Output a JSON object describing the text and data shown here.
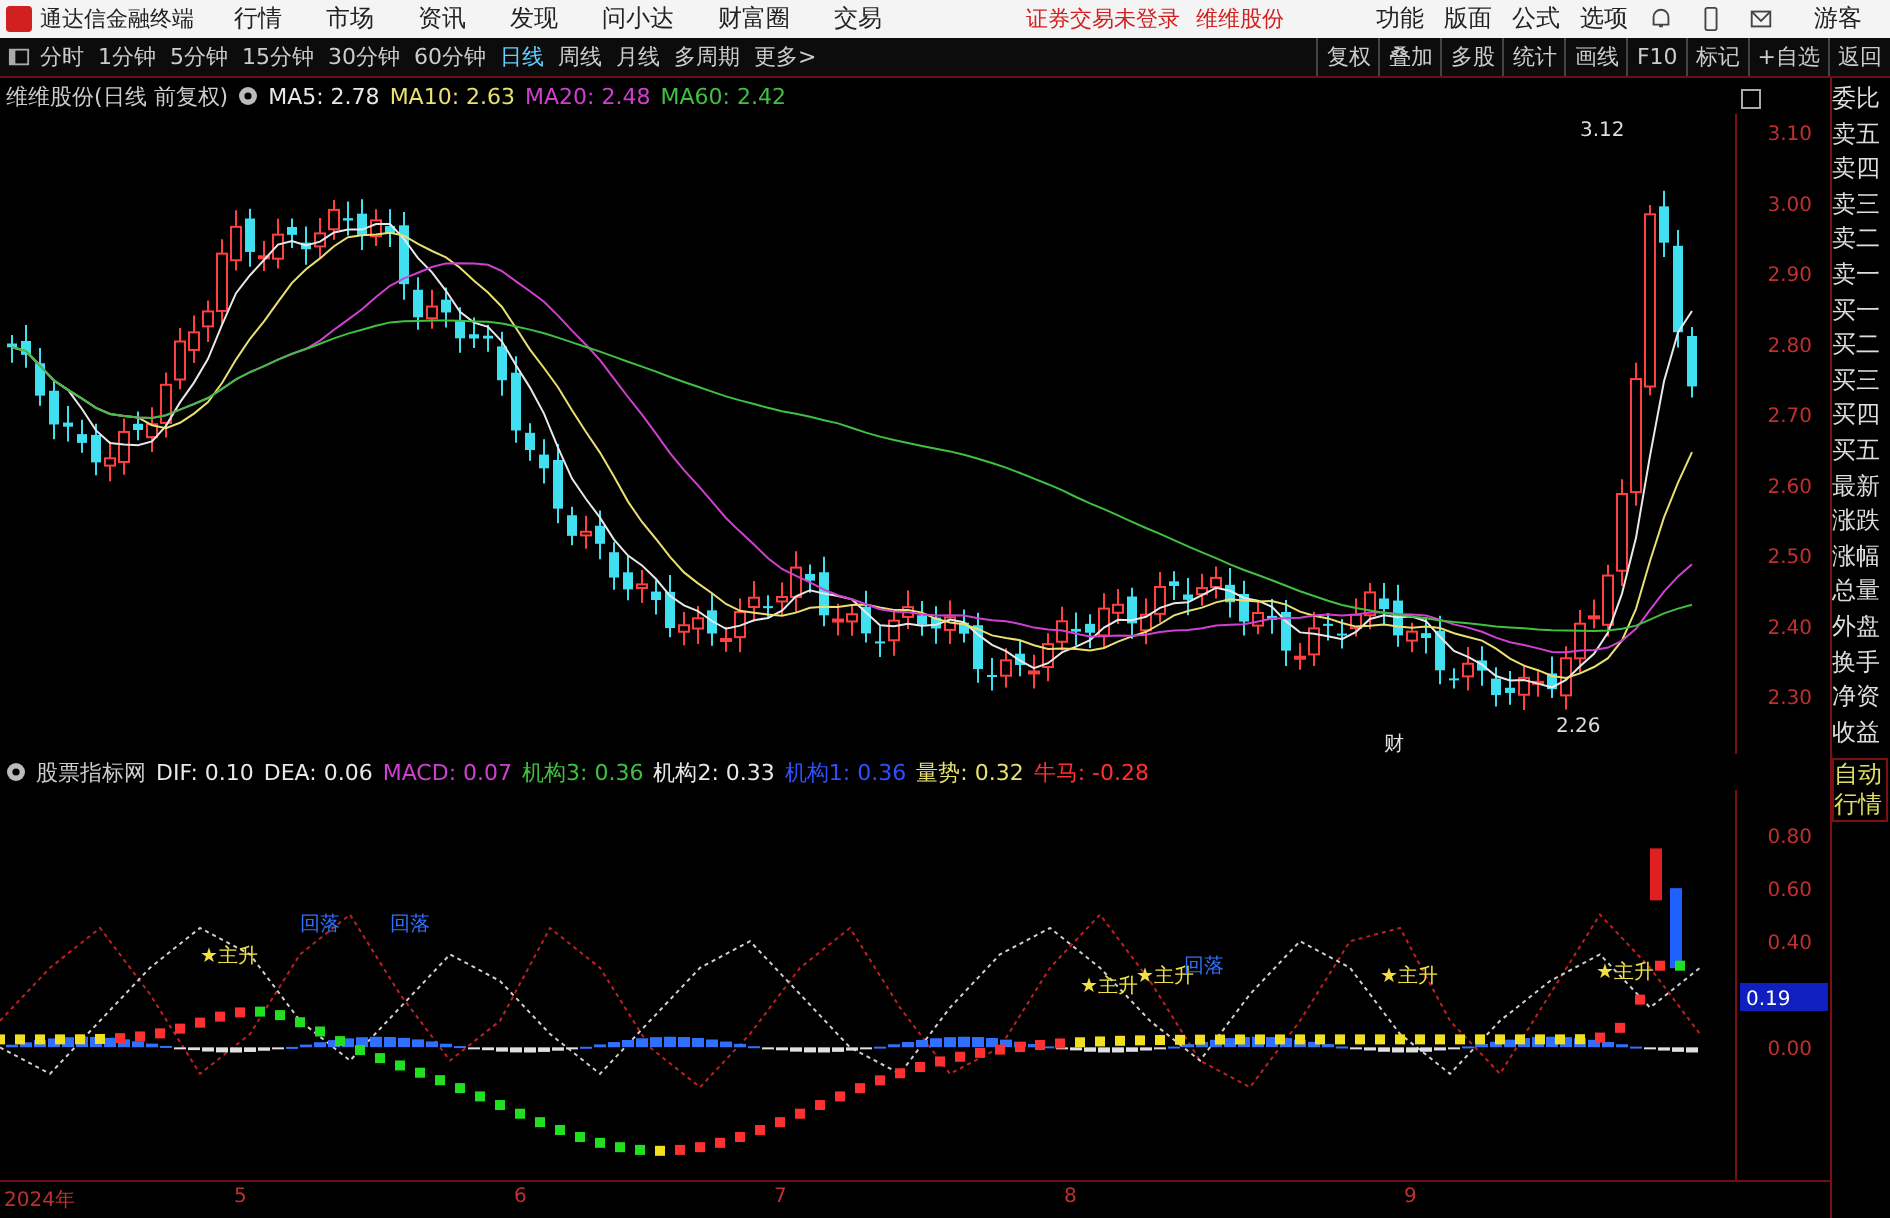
{
  "menubar": {
    "app_title": "通达信金融终端",
    "menus": [
      "行情",
      "市场",
      "资讯",
      "发现",
      "问小达",
      "财富圈",
      "交易"
    ],
    "notices": [
      "证券交易未登录",
      "维维股份"
    ],
    "actions": [
      "功能",
      "版面",
      "公式",
      "选项"
    ],
    "user": "游客"
  },
  "toolbar": {
    "periods": [
      {
        "label": "分时",
        "selected": false
      },
      {
        "label": "1分钟",
        "selected": false
      },
      {
        "label": "5分钟",
        "selected": false
      },
      {
        "label": "15分钟",
        "selected": false
      },
      {
        "label": "30分钟",
        "selected": false
      },
      {
        "label": "60分钟",
        "selected": false
      },
      {
        "label": "日线",
        "selected": true
      },
      {
        "label": "周线",
        "selected": false
      },
      {
        "label": "月线",
        "selected": false
      },
      {
        "label": "多周期",
        "selected": false
      }
    ],
    "more": "更多>",
    "tools": [
      "复权",
      "叠加",
      "多股",
      "统计",
      "画线",
      "F10",
      "标记",
      "+自选",
      "返回"
    ]
  },
  "chart": {
    "title": "维维股份(日线 前复权)",
    "ma": [
      {
        "label": "MA5: 2.78",
        "color": "#e8e8e8"
      },
      {
        "label": "MA10: 2.63",
        "color": "#e8e070"
      },
      {
        "label": "MA20: 2.48",
        "color": "#d040d0"
      },
      {
        "label": "MA60: 2.42",
        "color": "#40c040"
      }
    ],
    "price_ticks": [
      "3.10",
      "3.00",
      "2.90",
      "2.80",
      "2.70",
      "2.60",
      "2.50",
      "2.40",
      "2.30"
    ],
    "high_label": "3.12",
    "low_label": "2.26",
    "marker": "财"
  },
  "indicator": {
    "title": "股票指标网",
    "values": [
      {
        "label": "DIF: 0.10",
        "color": "#e8e8e8"
      },
      {
        "label": "DEA: 0.06",
        "color": "#e8e8e8"
      },
      {
        "label": "MACD: 0.07",
        "color": "#d040d0"
      },
      {
        "label": "机构3: 0.36",
        "color": "#40c040"
      },
      {
        "label": "机构2: 0.33",
        "color": "#e8e8e8"
      },
      {
        "label": "机构1: 0.36",
        "color": "#3050ff"
      },
      {
        "label": "量势: 0.32",
        "color": "#e8e070"
      },
      {
        "label": "牛马: -0.28",
        "color": "#ff3030"
      }
    ],
    "chart_data": {
      "type": "line",
      "ylim": [
        -0.5,
        0.97
      ],
      "yticks": [
        {
          "value": 0.8,
          "label": "0.80"
        },
        {
          "value": 0.6,
          "label": "0.60"
        },
        {
          "value": 0.4,
          "label": "0.40"
        },
        {
          "value": 0,
          "label": "0.00"
        }
      ],
      "series": [
        {
          "color": "#c02020",
          "line_style": "dashed",
          "values": [
            0.1,
            0.3,
            0.45,
            0.2,
            -0.1,
            0.05,
            0.35,
            0.5,
            0.2,
            -0.05,
            0.1,
            0.45,
            0.3,
            0.0,
            -0.15,
            0.05,
            0.3,
            0.45,
            0.15,
            -0.1,
            0.0,
            0.3,
            0.5,
            0.25,
            -0.05,
            -0.15,
            0.1,
            0.4,
            0.45,
            0.1,
            -0.1,
            0.2,
            0.5,
            0.3,
            0.05
          ]
        },
        {
          "color": "#d0d0d0",
          "line_style": "dashed",
          "values": [
            0.0,
            -0.1,
            0.1,
            0.3,
            0.45,
            0.35,
            0.1,
            -0.05,
            0.15,
            0.35,
            0.25,
            0.05,
            -0.1,
            0.1,
            0.3,
            0.4,
            0.2,
            0.0,
            -0.1,
            0.15,
            0.35,
            0.45,
            0.3,
            0.1,
            -0.05,
            0.2,
            0.4,
            0.3,
            0.05,
            -0.1,
            0.1,
            0.25,
            0.35,
            0.15,
            0.3
          ]
        }
      ]
    },
    "current": "0.19",
    "signals": [
      {
        "kind": "rise",
        "text": "★主升"
      },
      {
        "kind": "fall",
        "text": "回落"
      },
      {
        "kind": "fall",
        "text": "回落"
      },
      {
        "kind": "rise",
        "text": "★主升"
      },
      {
        "kind": "rise",
        "text": "★主升"
      },
      {
        "kind": "fall",
        "text": "回落"
      },
      {
        "kind": "rise",
        "text": "★主升"
      },
      {
        "kind": "rise",
        "text": "★主升"
      }
    ]
  },
  "dates": [
    "2024年",
    "5",
    "6",
    "7",
    "8",
    "9"
  ],
  "side_panel": {
    "items": [
      "委比",
      "卖五",
      "卖四",
      "卖三",
      "卖二",
      "卖一",
      "买一",
      "买二",
      "买三",
      "买四",
      "买五",
      "最新",
      "涨跌",
      "涨幅",
      "总量",
      "外盘",
      "换手",
      "净资",
      "收益"
    ],
    "auto_button": "自动行情"
  }
}
